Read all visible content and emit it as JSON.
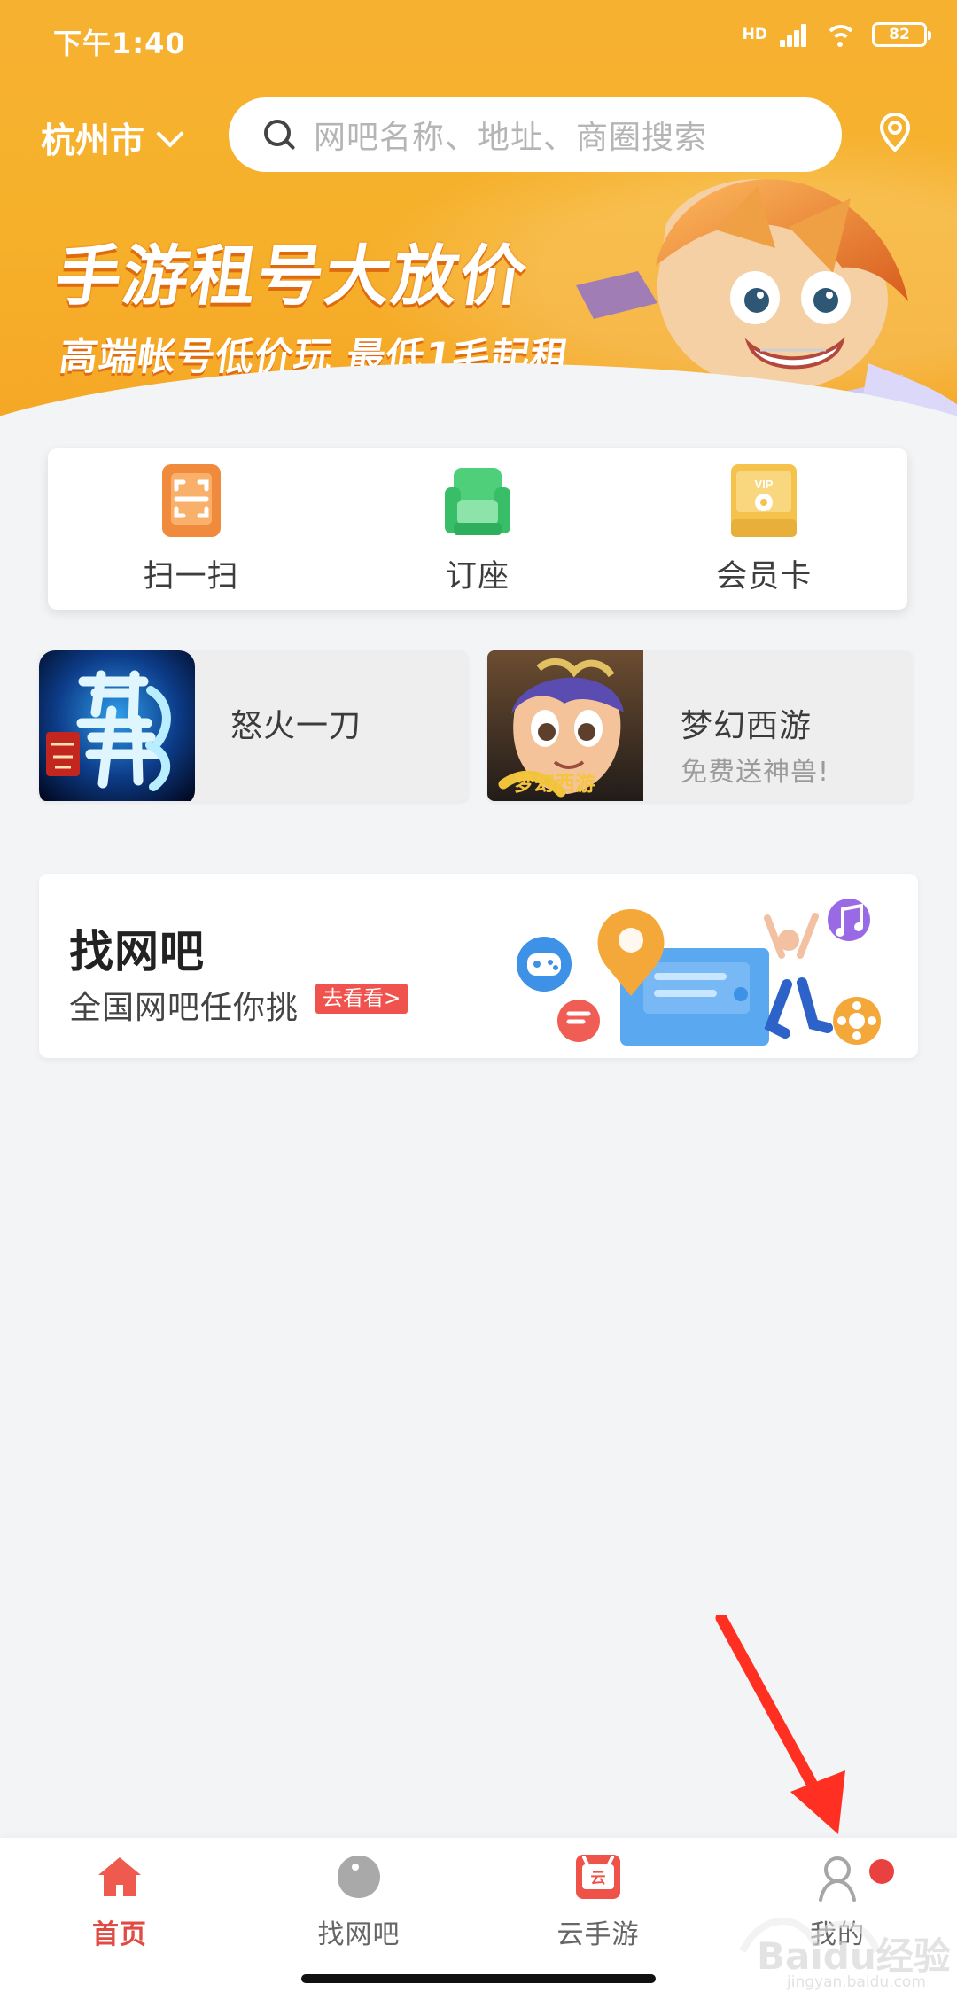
{
  "status_bar": {
    "time": "下午1:40",
    "battery": "82",
    "network": "HD"
  },
  "header": {
    "city": "杭州市",
    "search_placeholder": "网吧名称、地址、商圈搜索"
  },
  "banner": {
    "title": "手游租号大放价",
    "subtitle": "高端帐号低价玩 最低1毛起租"
  },
  "quick_actions": [
    {
      "label": "扫一扫",
      "icon": "scan-icon",
      "color": "#f08a3c"
    },
    {
      "label": "订座",
      "icon": "seat-icon",
      "color": "#4fcf7a"
    },
    {
      "label": "会员卡",
      "icon": "vip-card-icon",
      "color": "#f5c24c"
    }
  ],
  "game_cards": [
    {
      "name": "怒火一刀",
      "subtitle": ""
    },
    {
      "name": "梦幻西游",
      "subtitle": "免费送神兽!"
    }
  ],
  "find_cafe": {
    "title": "找网吧",
    "subtitle": "全国网吧任你挑",
    "link": "去看看>"
  },
  "bottom_nav": [
    {
      "label": "首页",
      "icon": "home-icon",
      "active": true
    },
    {
      "label": "找网吧",
      "icon": "find-cafe-icon",
      "active": false
    },
    {
      "label": "云手游",
      "icon": "cloud-game-icon",
      "active": false
    },
    {
      "label": "我的",
      "icon": "profile-icon",
      "active": false
    }
  ],
  "colors": {
    "accent": "#e04c43",
    "banner": "#f6b12b",
    "notification": "#e9413f"
  },
  "watermark": "Baidu经验"
}
